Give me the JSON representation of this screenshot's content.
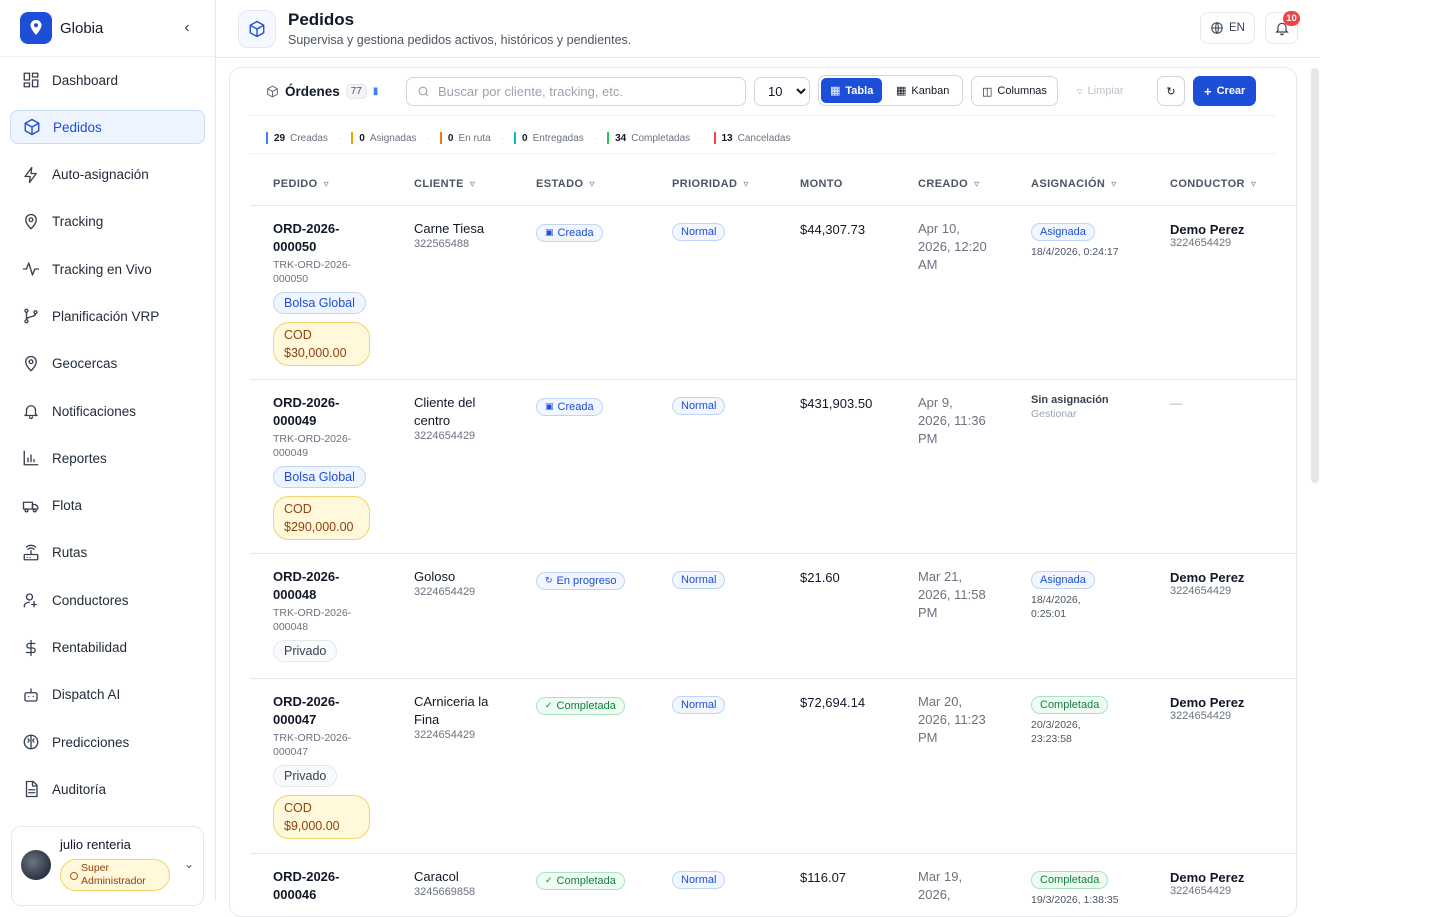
{
  "app": {
    "name": "Globia",
    "collapse_glyph": "‹"
  },
  "sidebar": {
    "items": [
      {
        "label": "Dashboard",
        "icon": "dashboard-icon"
      },
      {
        "label": "Pedidos",
        "icon": "box-icon",
        "active": true
      },
      {
        "label": "Auto-asignación",
        "icon": "bolt-icon"
      },
      {
        "label": "Tracking",
        "icon": "map-pin-icon"
      },
      {
        "label": "Tracking en Vivo",
        "icon": "activity-icon"
      },
      {
        "label": "Planificación VRP",
        "icon": "route-icon"
      },
      {
        "label": "Geocercas",
        "icon": "map-pin-icon"
      },
      {
        "label": "Notificaciones",
        "icon": "bell-icon"
      },
      {
        "label": "Reportes",
        "icon": "bar-chart-icon"
      },
      {
        "label": "Flota",
        "icon": "truck-icon"
      },
      {
        "label": "Rutas",
        "icon": "router-icon"
      },
      {
        "label": "Conductores",
        "icon": "user-icon"
      },
      {
        "label": "Rentabilidad",
        "icon": "dollar-icon"
      },
      {
        "label": "Dispatch AI",
        "icon": "bot-icon"
      },
      {
        "label": "Predicciones",
        "icon": "brain-icon"
      },
      {
        "label": "Auditoría",
        "icon": "file-icon"
      }
    ],
    "user": {
      "name": "julio renteria",
      "role_line1": "Super",
      "role_line2": "Administrador"
    }
  },
  "header": {
    "title": "Pedidos",
    "subtitle": "Supervisa y gestiona pedidos activos, históricos y pendientes.",
    "lang": "EN",
    "notif_count": "10"
  },
  "toolbar": {
    "title": "Órdenes",
    "count": "77",
    "search_placeholder": "Buscar por cliente, tracking, etc.",
    "page_size": "10",
    "page_size_options": [
      "10"
    ],
    "view_table": "Tabla",
    "view_kanban": "Kanban",
    "columns": "Columnas",
    "clear": "Limpiar",
    "create": "Crear"
  },
  "stats": [
    {
      "count": "29",
      "label": "Creadas",
      "color": "#3b82f6"
    },
    {
      "count": "0",
      "label": "Asignadas",
      "color": "#f59e0b"
    },
    {
      "count": "0",
      "label": "En ruta",
      "color": "#f97316"
    },
    {
      "count": "0",
      "label": "Entregadas",
      "color": "#06b6d4"
    },
    {
      "count": "34",
      "label": "Completadas",
      "color": "#22c55e"
    },
    {
      "count": "13",
      "label": "Canceladas",
      "color": "#ef4444"
    }
  ],
  "table": {
    "columns": [
      "PEDIDO",
      "CLIENTE",
      "ESTADO",
      "PRIORIDAD",
      "MONTO",
      "CREADO",
      "ASIGNACIÓN",
      "CONDUCTOR"
    ],
    "rows": [
      {
        "id1": "ORD-2026-",
        "id2": "000050",
        "trk1": "TRK-ORD-2026-",
        "trk2": "000050",
        "pool": "Bolsa Global",
        "cod_label": "COD",
        "cod_amount": "$30,000.00",
        "client1": "Carne Tiesa",
        "client2": "",
        "phone": "322565488",
        "state": "Creada",
        "priority": "Normal",
        "amount": "$44,307.73",
        "created1": "Apr 10,",
        "created2": "2026, 12:20",
        "created3": "AM",
        "asg": "Asignada",
        "asg_date1": "18/4/2026, 0:24:17",
        "asg_date2": "",
        "driver": "Demo Perez",
        "driver_phone": "3224654429"
      },
      {
        "id1": "ORD-2026-",
        "id2": "000049",
        "trk1": "TRK-ORD-2026-",
        "trk2": "000049",
        "pool": "Bolsa Global",
        "cod_label": "COD",
        "cod_amount": "$290,000.00",
        "client1": "Cliente del",
        "client2": "centro",
        "phone": "3224654429",
        "state": "Creada",
        "priority": "Normal",
        "amount": "$431,903.50",
        "created1": "Apr 9,",
        "created2": "2026, 11:36",
        "created3": "PM",
        "noasg": "Sin asignación",
        "manage": "Gestionar",
        "no_driver": "—"
      },
      {
        "id1": "ORD-2026-",
        "id2": "000048",
        "trk1": "TRK-ORD-2026-",
        "trk2": "000048",
        "pool": "Privado",
        "client1": "Goloso",
        "client2": "",
        "phone": "3224654429",
        "state": "En progreso",
        "priority": "Normal",
        "amount": "$21.60",
        "created1": "Mar 21,",
        "created2": "2026, 11:58",
        "created3": "PM",
        "asg": "Asignada",
        "asg_date1": "18/4/2026,",
        "asg_date2": "0:25:01",
        "driver": "Demo Perez",
        "driver_phone": "3224654429"
      },
      {
        "id1": "ORD-2026-",
        "id2": "000047",
        "trk1": "TRK-ORD-2026-",
        "trk2": "000047",
        "pool": "Privado",
        "cod_label": "COD",
        "cod_amount": "$9,000.00",
        "client1": "CArniceria la",
        "client2": "Fina",
        "phone": "3224654429",
        "state": "Completada",
        "priority": "Normal",
        "amount": "$72,694.14",
        "created1": "Mar 20,",
        "created2": "2026, 11:23",
        "created3": "PM",
        "asg": "Completada",
        "asg_date1": "20/3/2026,",
        "asg_date2": "23:23:58",
        "driver": "Demo Perez",
        "driver_phone": "3224654429"
      },
      {
        "id1": "ORD-2026-",
        "id2": "000046",
        "client1": "Caracol",
        "client2": "",
        "phone": "3245669858",
        "state": "Completada",
        "priority": "Normal",
        "amount": "$116.07",
        "created1": "Mar 19,",
        "created2": "2026,",
        "created3": "",
        "asg": "Completada",
        "asg_date1": "19/3/2026, 1:38:35",
        "asg_date2": "",
        "driver": "Demo Perez",
        "driver_phone": "3224654429"
      }
    ]
  }
}
